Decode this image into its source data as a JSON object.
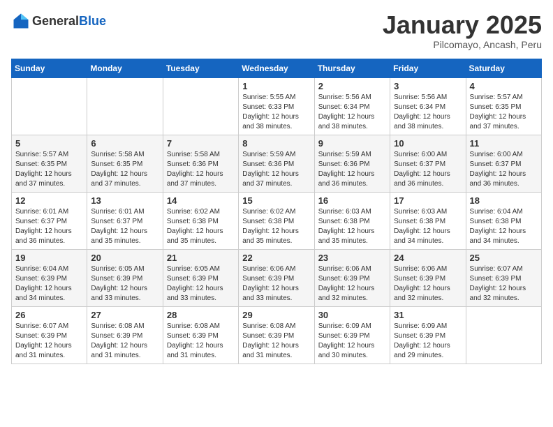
{
  "header": {
    "logo_general": "General",
    "logo_blue": "Blue",
    "month": "January 2025",
    "location": "Pilcomayo, Ancash, Peru"
  },
  "days_of_week": [
    "Sunday",
    "Monday",
    "Tuesday",
    "Wednesday",
    "Thursday",
    "Friday",
    "Saturday"
  ],
  "weeks": [
    [
      {
        "day": "",
        "info": ""
      },
      {
        "day": "",
        "info": ""
      },
      {
        "day": "",
        "info": ""
      },
      {
        "day": "1",
        "info": "Sunrise: 5:55 AM\nSunset: 6:33 PM\nDaylight: 12 hours\nand 38 minutes."
      },
      {
        "day": "2",
        "info": "Sunrise: 5:56 AM\nSunset: 6:34 PM\nDaylight: 12 hours\nand 38 minutes."
      },
      {
        "day": "3",
        "info": "Sunrise: 5:56 AM\nSunset: 6:34 PM\nDaylight: 12 hours\nand 38 minutes."
      },
      {
        "day": "4",
        "info": "Sunrise: 5:57 AM\nSunset: 6:35 PM\nDaylight: 12 hours\nand 37 minutes."
      }
    ],
    [
      {
        "day": "5",
        "info": "Sunrise: 5:57 AM\nSunset: 6:35 PM\nDaylight: 12 hours\nand 37 minutes."
      },
      {
        "day": "6",
        "info": "Sunrise: 5:58 AM\nSunset: 6:35 PM\nDaylight: 12 hours\nand 37 minutes."
      },
      {
        "day": "7",
        "info": "Sunrise: 5:58 AM\nSunset: 6:36 PM\nDaylight: 12 hours\nand 37 minutes."
      },
      {
        "day": "8",
        "info": "Sunrise: 5:59 AM\nSunset: 6:36 PM\nDaylight: 12 hours\nand 37 minutes."
      },
      {
        "day": "9",
        "info": "Sunrise: 5:59 AM\nSunset: 6:36 PM\nDaylight: 12 hours\nand 36 minutes."
      },
      {
        "day": "10",
        "info": "Sunrise: 6:00 AM\nSunset: 6:37 PM\nDaylight: 12 hours\nand 36 minutes."
      },
      {
        "day": "11",
        "info": "Sunrise: 6:00 AM\nSunset: 6:37 PM\nDaylight: 12 hours\nand 36 minutes."
      }
    ],
    [
      {
        "day": "12",
        "info": "Sunrise: 6:01 AM\nSunset: 6:37 PM\nDaylight: 12 hours\nand 36 minutes."
      },
      {
        "day": "13",
        "info": "Sunrise: 6:01 AM\nSunset: 6:37 PM\nDaylight: 12 hours\nand 35 minutes."
      },
      {
        "day": "14",
        "info": "Sunrise: 6:02 AM\nSunset: 6:38 PM\nDaylight: 12 hours\nand 35 minutes."
      },
      {
        "day": "15",
        "info": "Sunrise: 6:02 AM\nSunset: 6:38 PM\nDaylight: 12 hours\nand 35 minutes."
      },
      {
        "day": "16",
        "info": "Sunrise: 6:03 AM\nSunset: 6:38 PM\nDaylight: 12 hours\nand 35 minutes."
      },
      {
        "day": "17",
        "info": "Sunrise: 6:03 AM\nSunset: 6:38 PM\nDaylight: 12 hours\nand 34 minutes."
      },
      {
        "day": "18",
        "info": "Sunrise: 6:04 AM\nSunset: 6:38 PM\nDaylight: 12 hours\nand 34 minutes."
      }
    ],
    [
      {
        "day": "19",
        "info": "Sunrise: 6:04 AM\nSunset: 6:39 PM\nDaylight: 12 hours\nand 34 minutes."
      },
      {
        "day": "20",
        "info": "Sunrise: 6:05 AM\nSunset: 6:39 PM\nDaylight: 12 hours\nand 33 minutes."
      },
      {
        "day": "21",
        "info": "Sunrise: 6:05 AM\nSunset: 6:39 PM\nDaylight: 12 hours\nand 33 minutes."
      },
      {
        "day": "22",
        "info": "Sunrise: 6:06 AM\nSunset: 6:39 PM\nDaylight: 12 hours\nand 33 minutes."
      },
      {
        "day": "23",
        "info": "Sunrise: 6:06 AM\nSunset: 6:39 PM\nDaylight: 12 hours\nand 32 minutes."
      },
      {
        "day": "24",
        "info": "Sunrise: 6:06 AM\nSunset: 6:39 PM\nDaylight: 12 hours\nand 32 minutes."
      },
      {
        "day": "25",
        "info": "Sunrise: 6:07 AM\nSunset: 6:39 PM\nDaylight: 12 hours\nand 32 minutes."
      }
    ],
    [
      {
        "day": "26",
        "info": "Sunrise: 6:07 AM\nSunset: 6:39 PM\nDaylight: 12 hours\nand 31 minutes."
      },
      {
        "day": "27",
        "info": "Sunrise: 6:08 AM\nSunset: 6:39 PM\nDaylight: 12 hours\nand 31 minutes."
      },
      {
        "day": "28",
        "info": "Sunrise: 6:08 AM\nSunset: 6:39 PM\nDaylight: 12 hours\nand 31 minutes."
      },
      {
        "day": "29",
        "info": "Sunrise: 6:08 AM\nSunset: 6:39 PM\nDaylight: 12 hours\nand 31 minutes."
      },
      {
        "day": "30",
        "info": "Sunrise: 6:09 AM\nSunset: 6:39 PM\nDaylight: 12 hours\nand 30 minutes."
      },
      {
        "day": "31",
        "info": "Sunrise: 6:09 AM\nSunset: 6:39 PM\nDaylight: 12 hours\nand 29 minutes."
      },
      {
        "day": "",
        "info": ""
      }
    ]
  ]
}
